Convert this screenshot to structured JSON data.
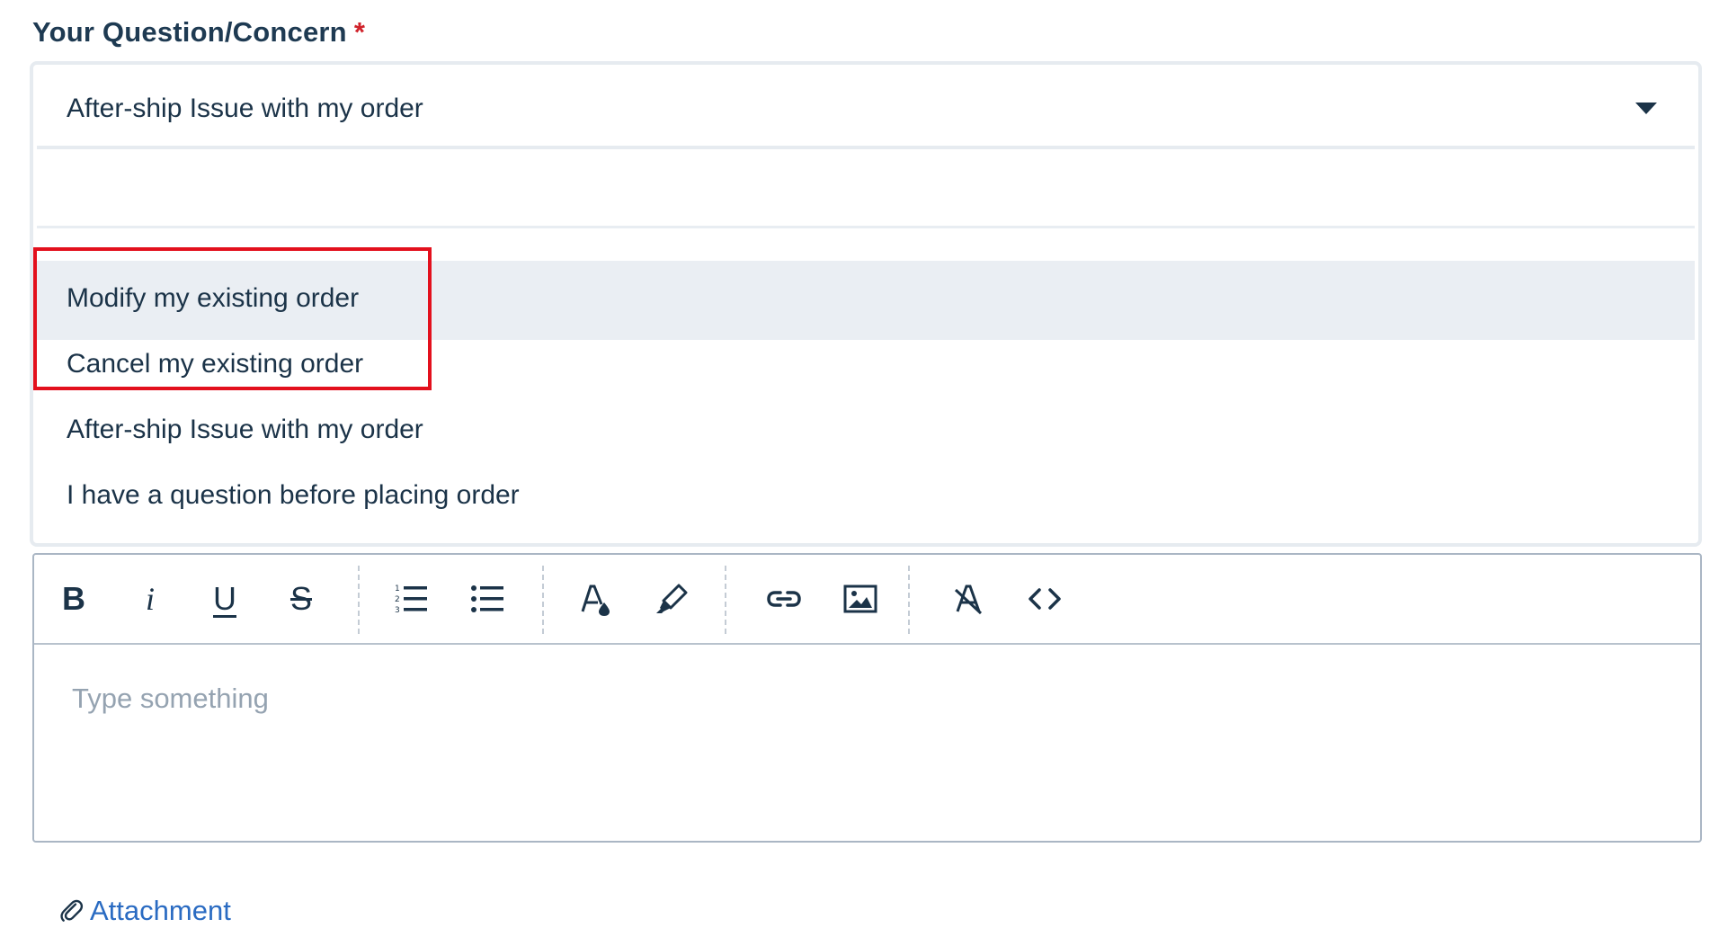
{
  "form": {
    "label": "Your Question/Concern",
    "required_mark": "*"
  },
  "select": {
    "value": "After-ship Issue with my order",
    "options": [
      {
        "label": "Modify my existing order",
        "highlighted": true
      },
      {
        "label": "Cancel my existing order",
        "highlighted": false
      },
      {
        "label": "After-ship Issue with my order",
        "highlighted": false
      },
      {
        "label": "I have a question before placing order",
        "highlighted": false
      }
    ]
  },
  "toolbar": {
    "buttons": [
      {
        "name": "bold",
        "glyph": "B"
      },
      {
        "name": "italic",
        "glyph": "i"
      },
      {
        "name": "underline",
        "glyph": "U"
      },
      {
        "name": "strikethrough",
        "glyph": "S"
      },
      {
        "name": "ordered-list",
        "icon": "ordered-list-icon"
      },
      {
        "name": "bullet-list",
        "icon": "bullet-list-icon"
      },
      {
        "name": "text-color",
        "icon": "text-color-icon"
      },
      {
        "name": "highlight",
        "icon": "highlighter-icon"
      },
      {
        "name": "link",
        "icon": "link-icon"
      },
      {
        "name": "image",
        "icon": "image-icon"
      },
      {
        "name": "clear-format",
        "icon": "clear-format-icon"
      },
      {
        "name": "code",
        "icon": "code-icon"
      }
    ]
  },
  "editor": {
    "placeholder": "Type something"
  },
  "attachment": {
    "label": "Attachment",
    "icon": "paperclip-icon"
  },
  "colors": {
    "text": "#1b3348",
    "required": "#d0222a",
    "highlight_row": "#eaeef3",
    "annotation": "#e3101d",
    "link": "#2a6bc2",
    "placeholder": "#95a3b1"
  }
}
